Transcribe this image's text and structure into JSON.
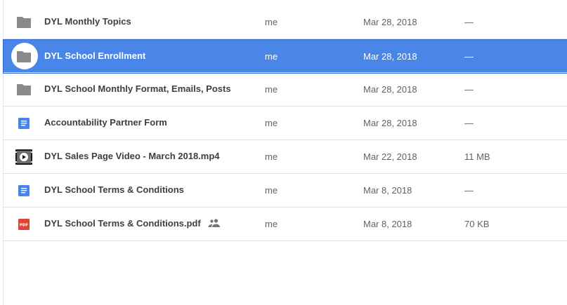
{
  "files": [
    {
      "name": "DYL Monthly Topics",
      "icon": "folder-icon",
      "owner": "me",
      "modified": "Mar 28, 2018",
      "size": "—",
      "selected": false,
      "shared": false
    },
    {
      "name": "DYL School Enrollment",
      "icon": "folder-icon",
      "owner": "me",
      "modified": "Mar 28, 2018",
      "size": "—",
      "selected": true,
      "shared": false
    },
    {
      "name": "DYL School Monthly Format, Emails, Posts",
      "icon": "folder-icon",
      "owner": "me",
      "modified": "Mar 28, 2018",
      "size": "—",
      "selected": false,
      "shared": false
    },
    {
      "name": "Accountability Partner Form",
      "icon": "google-doc-icon",
      "owner": "me",
      "modified": "Mar 28, 2018",
      "size": "—",
      "selected": false,
      "shared": false
    },
    {
      "name": "DYL Sales Page Video - March 2018.mp4",
      "icon": "video-file-icon",
      "owner": "me",
      "modified": "Mar 22, 2018",
      "size": "11 MB",
      "selected": false,
      "shared": false
    },
    {
      "name": "DYL School Terms & Conditions",
      "icon": "google-doc-icon",
      "owner": "me",
      "modified": "Mar 8, 2018",
      "size": "—",
      "selected": false,
      "shared": false
    },
    {
      "name": "DYL School Terms & Conditions.pdf",
      "icon": "pdf-file-icon",
      "owner": "me",
      "modified": "Mar 8, 2018",
      "size": "70 KB",
      "selected": false,
      "shared": true
    }
  ],
  "colors": {
    "selection": "#4a86e8",
    "folder": "#8a8a8a",
    "doc": "#4285f4",
    "pdf": "#db4437"
  }
}
